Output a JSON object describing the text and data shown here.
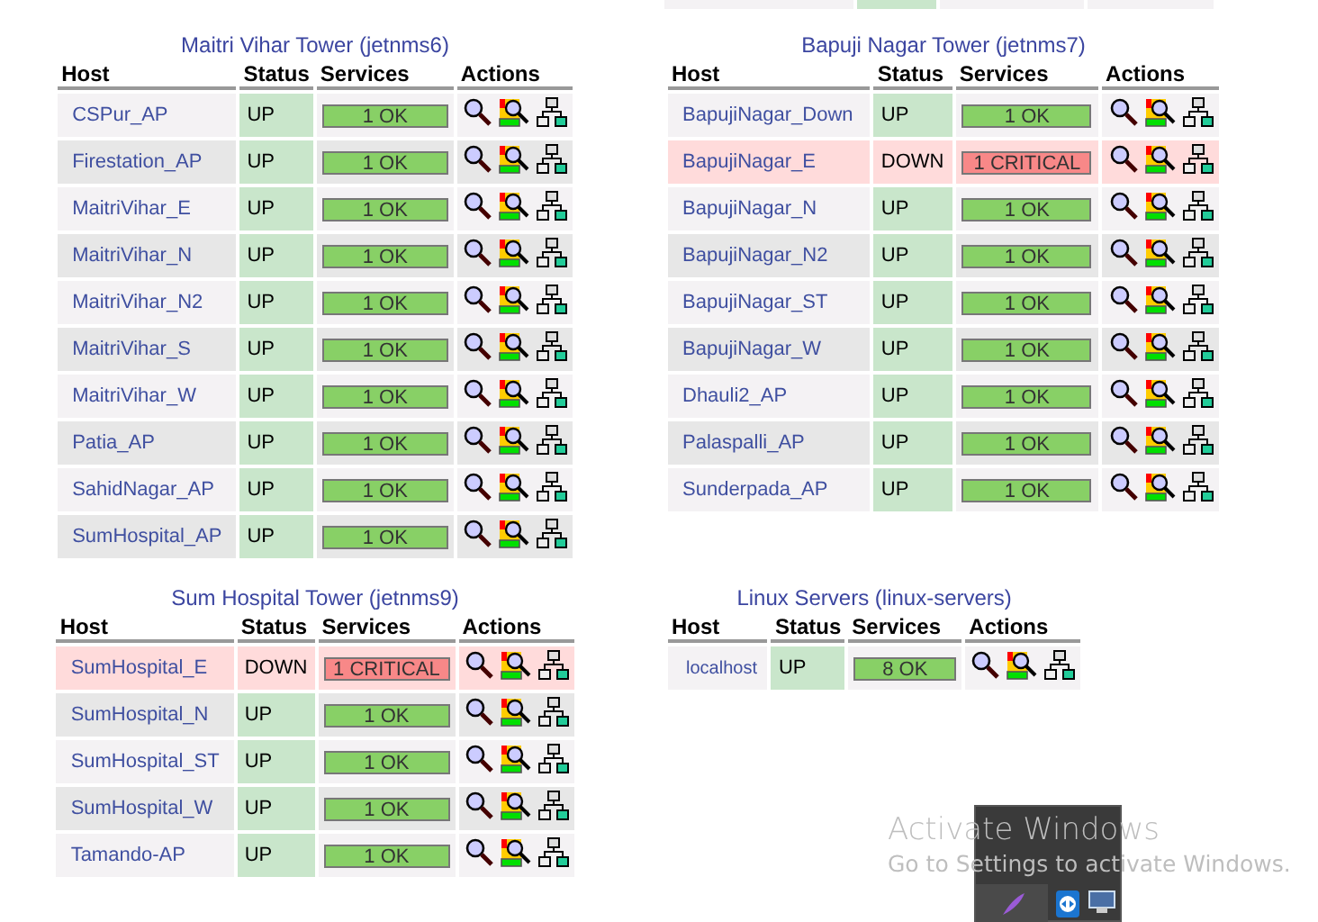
{
  "groups": [
    {
      "title": "Maitri Vihar Tower (jetnms6)",
      "columns": [
        "Host",
        "Status",
        "Services",
        "Actions"
      ],
      "rows": [
        {
          "host": "CSPur_AP",
          "status": "UP",
          "down": false,
          "services": "1 OK",
          "critical": false
        },
        {
          "host": "Firestation_AP",
          "status": "UP",
          "down": false,
          "services": "1 OK",
          "critical": false
        },
        {
          "host": "MaitriVihar_E",
          "status": "UP",
          "down": false,
          "services": "1 OK",
          "critical": false
        },
        {
          "host": "MaitriVihar_N",
          "status": "UP",
          "down": false,
          "services": "1 OK",
          "critical": false
        },
        {
          "host": "MaitriVihar_N2",
          "status": "UP",
          "down": false,
          "services": "1 OK",
          "critical": false
        },
        {
          "host": "MaitriVihar_S",
          "status": "UP",
          "down": false,
          "services": "1 OK",
          "critical": false
        },
        {
          "host": "MaitriVihar_W",
          "status": "UP",
          "down": false,
          "services": "1 OK",
          "critical": false
        },
        {
          "host": "Patia_AP",
          "status": "UP",
          "down": false,
          "services": "1 OK",
          "critical": false
        },
        {
          "host": "SahidNagar_AP",
          "status": "UP",
          "down": false,
          "services": "1 OK",
          "critical": false
        },
        {
          "host": "SumHospital_AP",
          "status": "UP",
          "down": false,
          "services": "1 OK",
          "critical": false
        }
      ]
    },
    {
      "title": "Bapuji Nagar Tower (jetnms7)",
      "columns": [
        "Host",
        "Status",
        "Services",
        "Actions"
      ],
      "rows": [
        {
          "host": "BapujiNagar_Down",
          "status": "UP",
          "down": false,
          "services": "1 OK",
          "critical": false
        },
        {
          "host": "BapujiNagar_E",
          "status": "DOWN",
          "down": true,
          "services": "1 CRITICAL",
          "critical": true
        },
        {
          "host": "BapujiNagar_N",
          "status": "UP",
          "down": false,
          "services": "1 OK",
          "critical": false
        },
        {
          "host": "BapujiNagar_N2",
          "status": "UP",
          "down": false,
          "services": "1 OK",
          "critical": false
        },
        {
          "host": "BapujiNagar_ST",
          "status": "UP",
          "down": false,
          "services": "1 OK",
          "critical": false
        },
        {
          "host": "BapujiNagar_W",
          "status": "UP",
          "down": false,
          "services": "1 OK",
          "critical": false
        },
        {
          "host": "Dhauli2_AP",
          "status": "UP",
          "down": false,
          "services": "1 OK",
          "critical": false
        },
        {
          "host": "Palaspalli_AP",
          "status": "UP",
          "down": false,
          "services": "1 OK",
          "critical": false
        },
        {
          "host": "Sunderpada_AP",
          "status": "UP",
          "down": false,
          "services": "1 OK",
          "critical": false
        }
      ]
    },
    {
      "title": "Sum Hospital Tower (jetnms9)",
      "columns": [
        "Host",
        "Status",
        "Services",
        "Actions"
      ],
      "rows": [
        {
          "host": "SumHospital_E",
          "status": "DOWN",
          "down": true,
          "services": "1 CRITICAL",
          "critical": true
        },
        {
          "host": "SumHospital_N",
          "status": "UP",
          "down": false,
          "services": "1 OK",
          "critical": false
        },
        {
          "host": "SumHospital_ST",
          "status": "UP",
          "down": false,
          "services": "1 OK",
          "critical": false
        },
        {
          "host": "SumHospital_W",
          "status": "UP",
          "down": false,
          "services": "1 OK",
          "critical": false
        },
        {
          "host": "Tamando-AP",
          "status": "UP",
          "down": false,
          "services": "1 OK",
          "critical": false
        }
      ]
    },
    {
      "title": "Linux Servers (linux-servers)",
      "columns": [
        "Host",
        "Status",
        "Services",
        "Actions"
      ],
      "rows": [
        {
          "host": "localhost",
          "status": "UP",
          "down": false,
          "services": "8 OK",
          "critical": false
        }
      ]
    }
  ],
  "activation_notice": {
    "title": "Activate Windows",
    "text": "Go to Settings to activate Windows."
  }
}
